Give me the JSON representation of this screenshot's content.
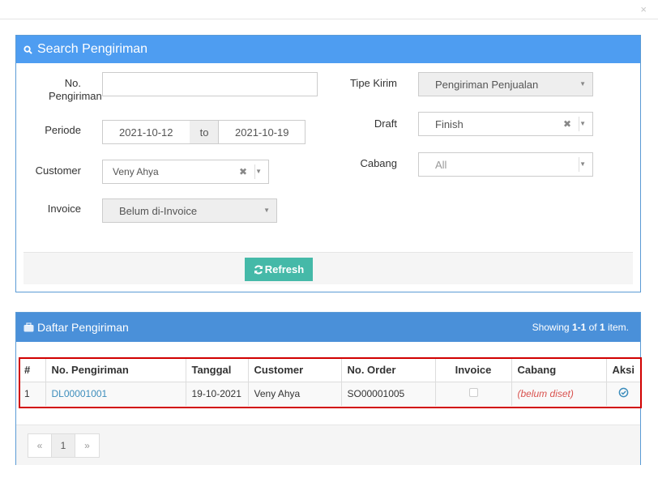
{
  "search": {
    "title": "Search Pengiriman",
    "no_pengiriman_label_line1": "No.",
    "no_pengiriman_label_line2": "Pengiriman",
    "no_pengiriman_value": "",
    "periode_label": "Periode",
    "periode_from": "2021-10-12",
    "periode_to_label": "to",
    "periode_to": "2021-10-19",
    "customer_label": "Customer",
    "customer_value": "Veny Ahya",
    "invoice_label": "Invoice",
    "invoice_value": "Belum di-Invoice",
    "tipe_kirim_label": "Tipe Kirim",
    "tipe_kirim_value": "Pengiriman Penjualan",
    "draft_label": "Draft",
    "draft_value": "Finish",
    "cabang_label": "Cabang",
    "cabang_value": "All",
    "refresh_label": "Refresh"
  },
  "list": {
    "title": "Daftar Pengiriman",
    "summary_prefix": "Showing ",
    "summary_range": "1-1",
    "summary_of": " of ",
    "summary_total": "1",
    "summary_suffix": " item.",
    "columns": [
      "#",
      "No. Pengiriman",
      "Tanggal",
      "Customer",
      "No. Order",
      "Invoice",
      "Cabang",
      "Aksi"
    ],
    "rows": [
      {
        "num": "1",
        "no_pengiriman": "DL00001001",
        "tanggal": "19-10-2021",
        "customer": "Veny Ahya",
        "no_order": "SO00001005",
        "invoice": "",
        "cabang": "(belum diset)"
      }
    ],
    "pager": {
      "prev": "«",
      "page": "1",
      "next": "»"
    }
  },
  "icons": {
    "close": "×",
    "search": "search-icon",
    "briefcase": "briefcase-icon",
    "refresh": "refresh-icon",
    "check": "check-circle-icon"
  },
  "colors": {
    "search_header": "#4e9df1",
    "list_header": "#4a90d9",
    "refresh_button": "#45b9a8",
    "highlight": "#d10000"
  }
}
